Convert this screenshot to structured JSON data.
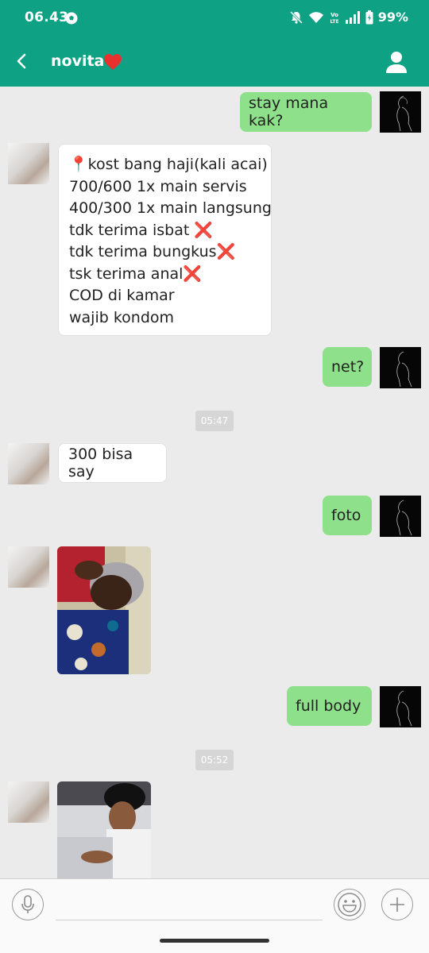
{
  "status_bar": {
    "time": "06.43",
    "battery": "99%",
    "volte_label": "Vo LTE"
  },
  "header": {
    "contact_name": "novita",
    "icons": [
      "back-arrow-icon",
      "heart-icon",
      "profile-icon"
    ]
  },
  "messages": [
    {
      "from": "me",
      "text": "stay mana kak?"
    },
    {
      "from": "her",
      "lines": [
        "📍kost bang haji(kali acai)",
        "700/600 1x main servis",
        "400/300 1x main langsung",
        "tdk terima isbat ❌",
        "tdk terima bungkus❌",
        "tsk terima anal❌",
        "COD di kamar",
        "wajib kondom"
      ]
    },
    {
      "from": "me",
      "text": "net?"
    },
    {
      "type": "timestamp",
      "text": "05:47"
    },
    {
      "from": "her",
      "text": "300 bisa say"
    },
    {
      "from": "me",
      "text": "foto"
    },
    {
      "from": "her",
      "type": "photo"
    },
    {
      "from": "me",
      "text": "full body"
    },
    {
      "type": "timestamp",
      "text": "05:52"
    },
    {
      "from": "her",
      "type": "photo"
    }
  ],
  "input_bar": {
    "placeholder": "",
    "icons": [
      "microphone-icon",
      "emoji-icon",
      "plus-icon"
    ]
  },
  "colors": {
    "header_bg": "#0fa184",
    "outgoing_bubble": "#8ee08a",
    "incoming_bubble": "#ffffff",
    "chat_bg": "#ebebeb"
  }
}
